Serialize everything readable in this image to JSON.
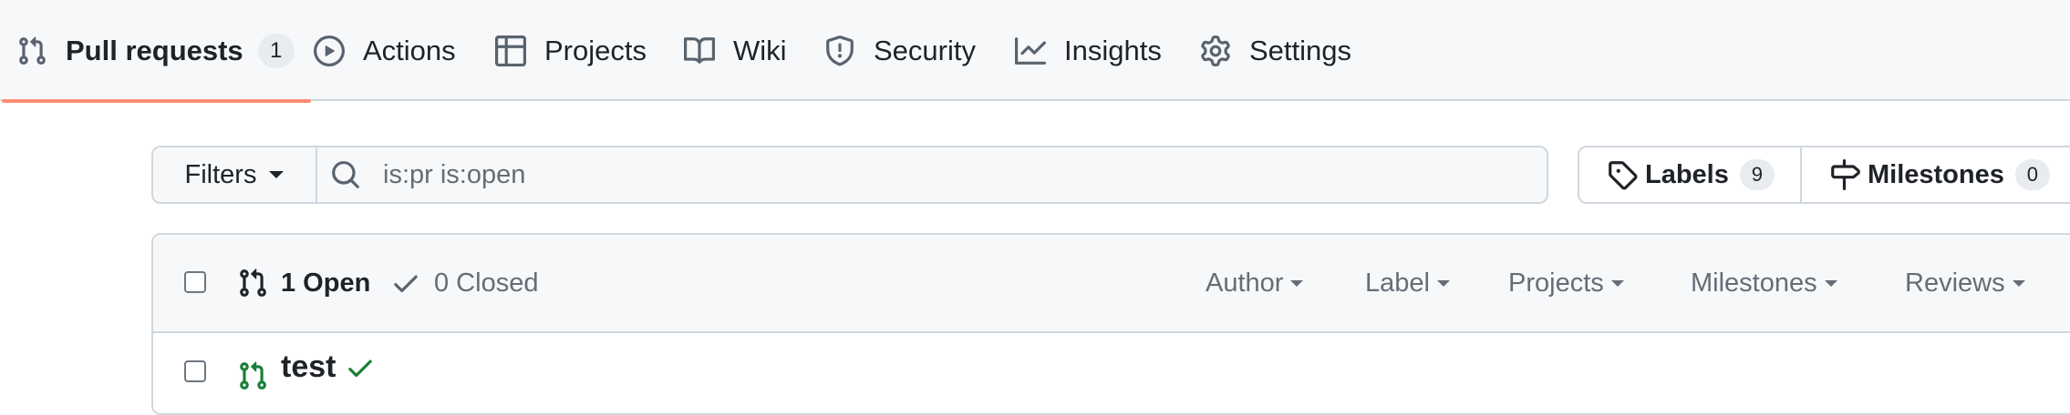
{
  "tabs": {
    "pull_requests": {
      "label": "Pull requests",
      "count": "1"
    },
    "actions": {
      "label": "Actions"
    },
    "projects": {
      "label": "Projects"
    },
    "wiki": {
      "label": "Wiki"
    },
    "security": {
      "label": "Security"
    },
    "insights": {
      "label": "Insights"
    },
    "settings": {
      "label": "Settings"
    }
  },
  "filterbar": {
    "filters_label": "Filters",
    "search_value": "is:pr is:open"
  },
  "labels_button": {
    "label": "Labels",
    "count": "9"
  },
  "milestones_button": {
    "label": "Milestones",
    "count": "0"
  },
  "list_header": {
    "open_label": "1 Open",
    "closed_label": "0 Closed",
    "filters": {
      "author": "Author",
      "label": "Label",
      "projects": "Projects",
      "milestones": "Milestones",
      "reviews": "Reviews"
    }
  },
  "pull_requests": [
    {
      "title": "test",
      "status": "success"
    }
  ],
  "colors": {
    "active_underline": "#fd8c73",
    "open_green": "#1a7f37",
    "muted": "#656d76"
  },
  "icons": {
    "pull_requests": "git-pull-request-icon",
    "actions": "play-icon",
    "projects": "table-icon",
    "wiki": "book-icon",
    "security": "shield-icon",
    "insights": "graph-icon",
    "settings": "gear-icon",
    "search": "search-icon",
    "labels": "tag-icon",
    "milestones": "milestone-icon",
    "closed": "check-icon"
  }
}
